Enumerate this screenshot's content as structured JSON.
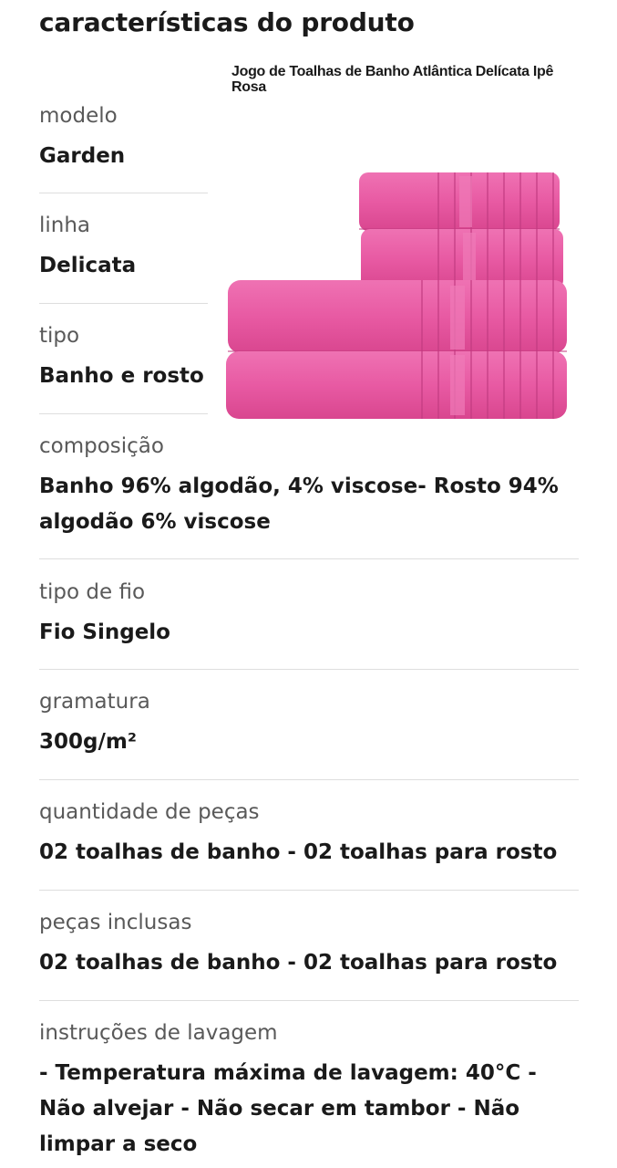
{
  "header": {
    "title": "características do produto"
  },
  "product_image": {
    "caption": "Jogo de Toalhas de Banho Atlântica Delícata Ipê Rosa",
    "color": "#e85aa3"
  },
  "specs": [
    {
      "label": "modelo",
      "value": "Garden"
    },
    {
      "label": "linha",
      "value": "Delicata"
    },
    {
      "label": "tipo",
      "value": "Banho e rosto"
    },
    {
      "label": "composição",
      "value": "Banho 96% algodão, 4% viscose- Rosto 94% algodão 6% viscose"
    },
    {
      "label": "tipo de fio",
      "value": "Fio Singelo"
    },
    {
      "label": "gramatura",
      "value": "300g/m²"
    },
    {
      "label": "quantidade de peças",
      "value": "02 toalhas de banho - 02 toalhas para rosto"
    },
    {
      "label": "peças inclusas",
      "value": "02 toalhas de banho - 02 toalhas para rosto"
    },
    {
      "label": "instruções de lavagem",
      "value": "- Temperatura máxima de lavagem: 40°C - Não alvejar - Não secar em tambor - Não limpar a seco"
    }
  ]
}
